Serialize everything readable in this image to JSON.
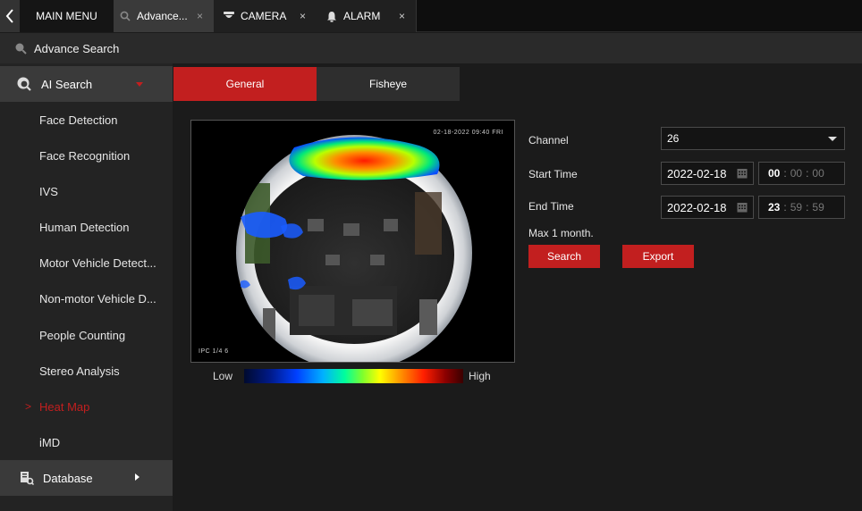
{
  "tabs": {
    "main_menu": "MAIN MENU",
    "advance": "Advance...",
    "camera": "CAMERA",
    "alarm": "ALARM",
    "close_glyph": "×"
  },
  "breadcrumb": {
    "title": "Advance Search"
  },
  "sidebar": {
    "group_label": "AI Search",
    "items": [
      {
        "label": "Face Detection"
      },
      {
        "label": "Face Recognition"
      },
      {
        "label": "IVS"
      },
      {
        "label": "Human Detection"
      },
      {
        "label": "Motor Vehicle Detect..."
      },
      {
        "label": "Non-motor Vehicle D..."
      },
      {
        "label": "People Counting"
      },
      {
        "label": "Stereo Analysis"
      },
      {
        "label": "Heat Map",
        "active": true
      },
      {
        "label": "iMD"
      }
    ],
    "active_marker": ">",
    "database_label": "Database"
  },
  "subtabs": {
    "general": "General",
    "fisheye": "Fisheye"
  },
  "preview": {
    "timestamp_top": "02-18-2022 09:40 FRI",
    "timestamp_bottom": "IPC 1/4 6"
  },
  "legend": {
    "low": "Low",
    "high": "High"
  },
  "form": {
    "channel_label": "Channel",
    "channel_value": "26",
    "start_label": "Start Time",
    "start_date": "2022-02-18",
    "start_time": {
      "h": "00",
      "m": "00",
      "s": "00"
    },
    "end_label": "End Time",
    "end_date": "2022-02-18",
    "end_time": {
      "h": "23",
      "m": "59",
      "s": "59"
    },
    "time_sep": ":",
    "max_note": "Max 1 month.",
    "search_label": "Search",
    "export_label": "Export"
  },
  "colors": {
    "accent": "#c21f1f",
    "panel": "#232323",
    "background": "#1b1b1b"
  }
}
